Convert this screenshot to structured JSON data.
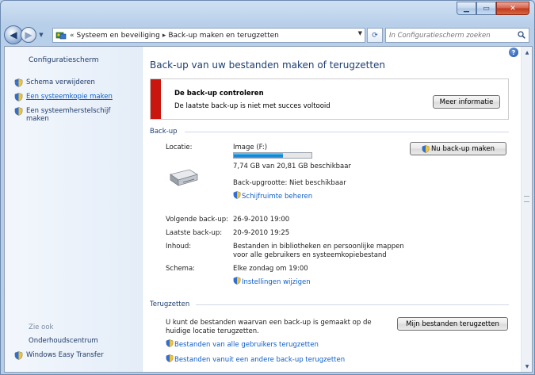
{
  "window": {
    "caption_buttons": [
      "minimize",
      "maximize",
      "close"
    ]
  },
  "address_bar": {
    "prefix": "«",
    "breadcrumbs": [
      "Systeem en beveiliging",
      "Back-up maken en terugzetten"
    ]
  },
  "search": {
    "placeholder": "In Configuratiescherm zoeken"
  },
  "left_pane": {
    "home": "Configuratiescherm",
    "items": [
      {
        "label": "Schema verwijderen",
        "icon": "shield-icon"
      },
      {
        "label": "Een systeemkopie maken",
        "icon": "shield-icon"
      },
      {
        "label": "Een systeemherstelschijf maken",
        "icon": "shield-icon"
      }
    ],
    "see_also": "Zie ook",
    "see_also_items": [
      {
        "label": "Onderhoudscentrum"
      },
      {
        "label": "Windows Easy Transfer",
        "icon": "shield-icon"
      }
    ]
  },
  "main": {
    "title": "Back-up van uw bestanden maken of terugzetten",
    "alert": {
      "title": "De back-up controleren",
      "message": "De laatste back-up is niet met succes voltooid",
      "button": "Meer informatie",
      "color": "#c9170f"
    },
    "backup_section": {
      "heading": "Back-up",
      "location_label": "Locatie:",
      "location_value": "Image (F:)",
      "progress_percent": 63,
      "space_text": "7,74 GB van 20,81 GB beschikbaar",
      "size_text": "Back-upgrootte: Niet beschikbaar",
      "manage_link": "Schijfruimte beheren",
      "backup_now_button": "Nu back-up maken",
      "next_label": "Volgende back-up:",
      "next_value": "26-9-2010 19:00",
      "last_label": "Laatste back-up:",
      "last_value": "20-9-2010 19:25",
      "content_label": "Inhoud:",
      "content_value_1": "Bestanden in bibliotheken en persoonlijke mappen",
      "content_value_2": "voor alle gebruikers en systeemkopiebestand",
      "schedule_label": "Schema:",
      "schedule_value": "Elke zondag om 19:00",
      "settings_link": "Instellingen wijzigen"
    },
    "restore_section": {
      "heading": "Terugzetten",
      "text_1": "U kunt de bestanden waarvan een back-up is gemaakt op de",
      "text_2": "huidige locatie terugzetten.",
      "restore_button": "Mijn bestanden terugzetten",
      "link_all_users": "Bestanden van alle gebruikers terugzetten",
      "link_other_backup": "Bestanden vanuit een andere back-up terugzetten"
    }
  }
}
